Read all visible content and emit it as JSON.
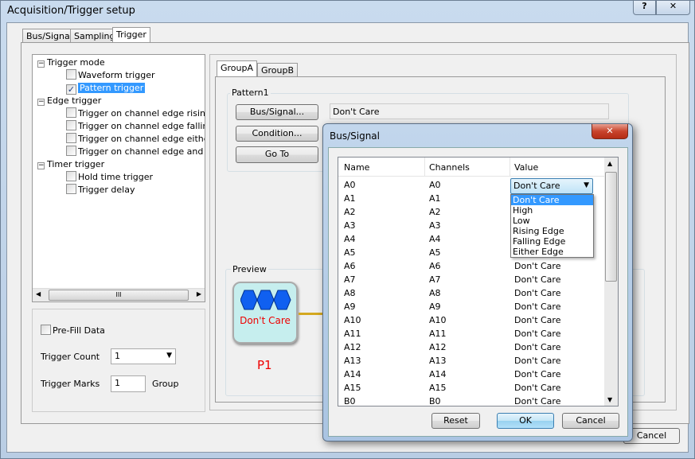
{
  "window": {
    "title": "Acquisition/Trigger setup",
    "help_label": "?",
    "close_label": "✕"
  },
  "tabs": [
    "Bus/Signal",
    "Sampling",
    "Trigger"
  ],
  "tree": {
    "groups": [
      {
        "label": "Trigger mode",
        "items": [
          {
            "label": "Waveform trigger",
            "checked": false
          },
          {
            "label": "Pattern trigger",
            "checked": true,
            "selected": true
          }
        ]
      },
      {
        "label": "Edge trigger",
        "items": [
          {
            "label": "Trigger on channel edge rising",
            "checked": false
          },
          {
            "label": "Trigger on channel edge falling",
            "checked": false
          },
          {
            "label": "Trigger on channel edge either",
            "checked": false
          },
          {
            "label": "Trigger on channel edge and patt",
            "checked": false
          }
        ]
      },
      {
        "label": "Timer trigger",
        "items": [
          {
            "label": "Hold time trigger",
            "checked": false
          },
          {
            "label": "Trigger delay",
            "checked": false
          }
        ]
      }
    ],
    "scroll_grip": "III"
  },
  "options": {
    "prefill_label": "Pre-Fill Data",
    "prefill_checked": false,
    "trigger_count_label": "Trigger Count",
    "trigger_count_value": "1",
    "trigger_marks_label": "Trigger Marks",
    "trigger_marks_value": "1",
    "group_label": "Group"
  },
  "group_tabs": [
    "GroupA",
    "GroupB"
  ],
  "pattern": {
    "title": "Pattern1",
    "bus_signal_btn": "Bus/Signal...",
    "condition_btn": "Condition...",
    "goto_btn": "Go To",
    "value": "Don't Care"
  },
  "preview": {
    "title": "Preview",
    "node_label": "Don't Care",
    "node_name": "P1"
  },
  "main_buttons": {
    "cancel": "Cancel"
  },
  "dialog": {
    "title": "Bus/Signal",
    "close_label": "✕",
    "columns": [
      "Name",
      "Channels",
      "Value"
    ],
    "rows": [
      [
        "A0",
        "A0",
        "Don't Care"
      ],
      [
        "A1",
        "A1",
        "Don't Care"
      ],
      [
        "A2",
        "A2",
        "Don't Care"
      ],
      [
        "A3",
        "A3",
        "Don't Care"
      ],
      [
        "A4",
        "A4",
        "Don't Care"
      ],
      [
        "A5",
        "A5",
        "Don't Care"
      ],
      [
        "A6",
        "A6",
        "Don't Care"
      ],
      [
        "A7",
        "A7",
        "Don't Care"
      ],
      [
        "A8",
        "A8",
        "Don't Care"
      ],
      [
        "A9",
        "A9",
        "Don't Care"
      ],
      [
        "A10",
        "A10",
        "Don't Care"
      ],
      [
        "A11",
        "A11",
        "Don't Care"
      ],
      [
        "A12",
        "A12",
        "Don't Care"
      ],
      [
        "A13",
        "A13",
        "Don't Care"
      ],
      [
        "A14",
        "A14",
        "Don't Care"
      ],
      [
        "A15",
        "A15",
        "Don't Care"
      ],
      [
        "B0",
        "B0",
        "Don't Care"
      ]
    ],
    "dropdown": {
      "value": "Don't Care",
      "options": [
        "Don't Care",
        "High",
        "Low",
        "Rising Edge",
        "Falling Edge",
        "Either Edge"
      ],
      "highlighted": 0
    },
    "buttons": {
      "reset": "Reset",
      "ok": "OK",
      "cancel": "Cancel"
    }
  }
}
